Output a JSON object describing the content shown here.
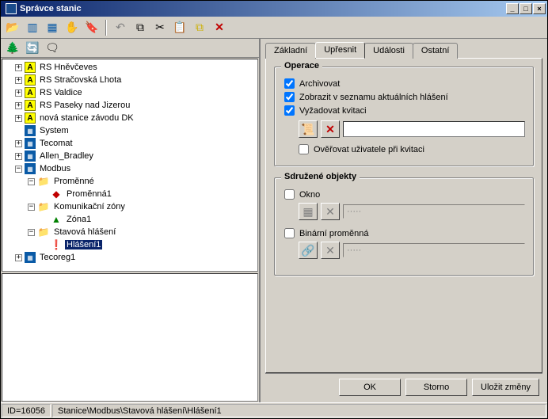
{
  "window": {
    "title": "Správce stanic"
  },
  "title_buttons": {
    "min": "_",
    "max": "□",
    "close": "×"
  },
  "toolbar1": {
    "open": "📂",
    "cols": "▥",
    "tile": "▦",
    "hand": "✋",
    "mark": "🔖",
    "undo": "↶",
    "copy": "⧉",
    "cut": "✂",
    "paste": "📋",
    "dup": "⧉",
    "del": "✕"
  },
  "toolbar2": {
    "tree": "🌲",
    "refresh": "🔄",
    "what": "🗨"
  },
  "tree": {
    "n1": "RS Hněvčeves",
    "n2": "RS Stračovská Lhota",
    "n3": "RS Valdice",
    "n4": "RS Paseky nad Jizerou",
    "n5": "nová stanice závodu DK",
    "n6": "System",
    "n7": "Tecomat",
    "n8": "Allen_Bradley",
    "n9": "Modbus",
    "n9a": "Proměnné",
    "n9a1": "Proměnná1",
    "n9b": "Komunikační zóny",
    "n9b1": "Zóna1",
    "n9c": "Stavová hlášení",
    "n9c1": "Hlášení1",
    "n10": "Tecoreg1"
  },
  "tabs": {
    "t1": "Základní",
    "t2": "Upřesnit",
    "t3": "Události",
    "t4": "Ostatní"
  },
  "group1": {
    "legend": "Operace",
    "archivovat": "Archivovat",
    "zobrazit": "Zobrazit v seznamu aktuálních hlášení",
    "vyzadovat": "Vyžadovat kvitaci",
    "overovat": "Ověřovat uživatele při kvitaci",
    "script_icon": "📜",
    "del_icon": "✕"
  },
  "group2": {
    "legend": "Sdružené objekty",
    "okno": "Okno",
    "binarni": "Binární proměnná",
    "dots": "·····",
    "grid_icon": "▦",
    "del_icon": "✕",
    "link_icon": "🔗"
  },
  "buttons": {
    "ok": "OK",
    "storno": "Storno",
    "ulozit": "Uložit změny"
  },
  "status": {
    "id": "ID=16056",
    "path": "Stanice\\Modbus\\Stavová hlášení\\Hlášení1"
  }
}
